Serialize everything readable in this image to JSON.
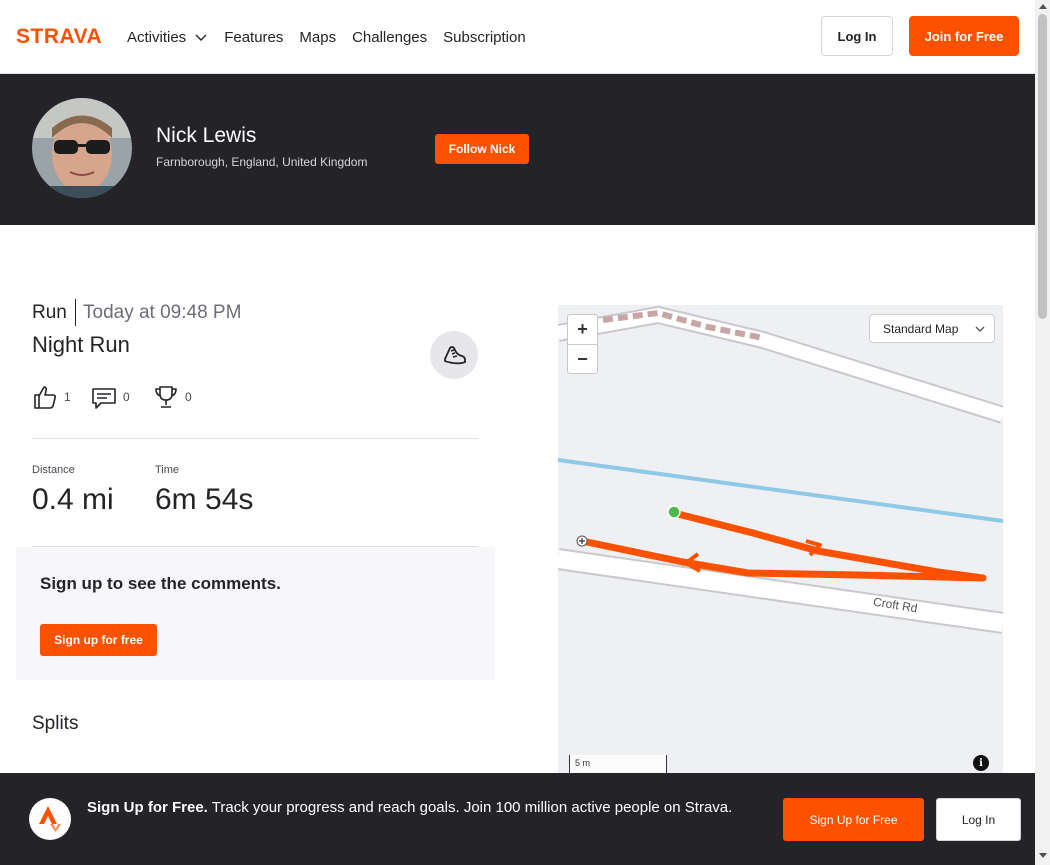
{
  "header": {
    "logo_text": "STRAVA",
    "nav": [
      "Activities",
      "Features",
      "Maps",
      "Challenges",
      "Subscription"
    ],
    "login_label": "Log In",
    "join_label": "Join for Free"
  },
  "athlete": {
    "name": "Nick Lewis",
    "location": "Farnborough, England, United Kingdom",
    "follow_label": "Follow Nick"
  },
  "activity": {
    "type": "Run",
    "time": "Today at 09:48 PM",
    "title": "Night Run",
    "kudos": "1",
    "comments": "0",
    "achievements": "0",
    "stats": [
      {
        "label": "Distance",
        "value": "0.4 mi"
      },
      {
        "label": "Time",
        "value": "6m 54s"
      }
    ]
  },
  "comments": {
    "title": "Sign up to see the comments.",
    "button": "Sign up for free"
  },
  "splits": {
    "title": "Splits"
  },
  "map": {
    "style_select": "Standard Map",
    "scale": "5 m",
    "road_label": "Croft Rd",
    "route_color": "#fc5200",
    "start_color": "#4cbb4a"
  },
  "bottom_banner": {
    "headline": "Sign Up for Free.",
    "text": "Track your progress and reach goals. Join 100 million active people on Strava.",
    "signup_label": "Sign Up for Free",
    "login_label": "Log In"
  },
  "colors": {
    "brand": "#fc5200",
    "dark": "#242428"
  }
}
